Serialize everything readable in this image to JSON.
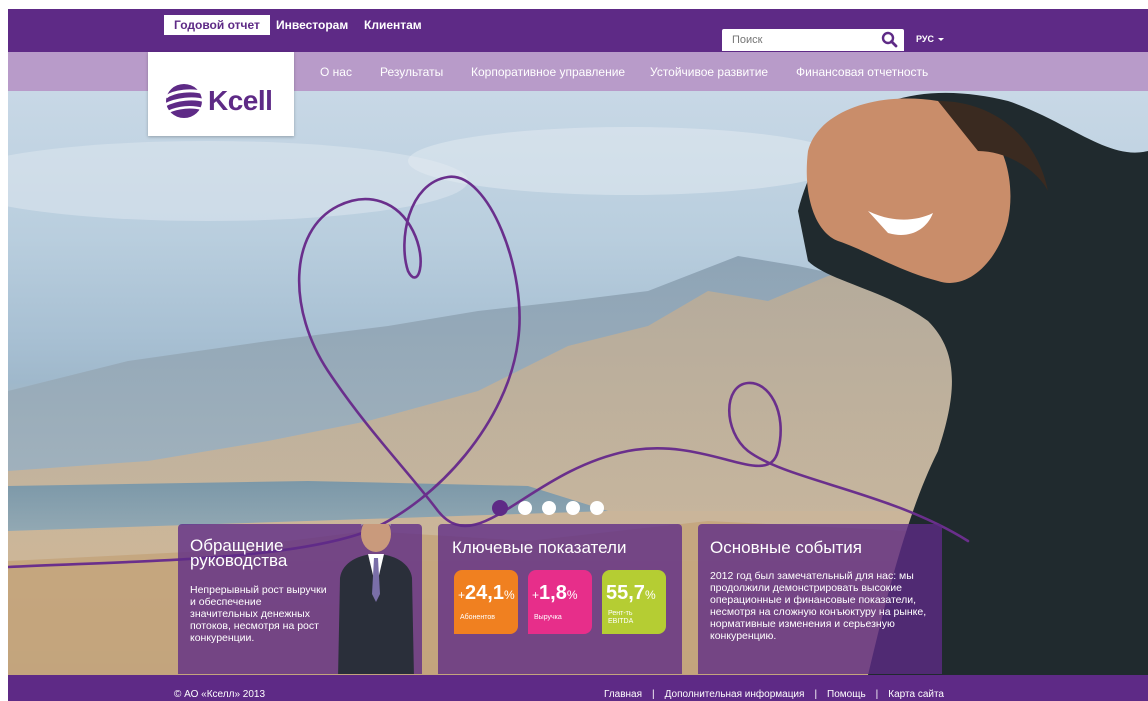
{
  "top_tabs": [
    {
      "label": "Годовой отчет",
      "active": true
    },
    {
      "label": "Инвесторам",
      "active": false
    },
    {
      "label": "Клиентам",
      "active": false
    }
  ],
  "search": {
    "placeholder": "Поиск",
    "icon": "search-icon"
  },
  "language": {
    "label": "РУС"
  },
  "nav": [
    {
      "label": "О нас"
    },
    {
      "label": "Результаты"
    },
    {
      "label": "Корпоративное управление"
    },
    {
      "label": "Устойчивое развитие"
    },
    {
      "label": "Финансовая отчетность"
    }
  ],
  "logo": {
    "text": "Kcell"
  },
  "carousel": {
    "total": 5,
    "active": 1
  },
  "panels": {
    "address": {
      "title": "Обращение руководства",
      "text": "Непрерывный рост выручки и обеспечение значительных денежных потоков, несмотря на рост конкуренции."
    },
    "indicators": {
      "title": "Ключевые показатели",
      "metrics": [
        {
          "sign": "+",
          "value": "24,1",
          "unit": "%",
          "label": "Абонентов",
          "color": "#f08020"
        },
        {
          "sign": "+",
          "value": "1,8",
          "unit": "%",
          "label": "Выручка",
          "color": "#e72e8a"
        },
        {
          "sign": "",
          "value": "55,7",
          "unit": "%",
          "label": "Рент-ть EBITDA",
          "color": "#b5cd33"
        }
      ]
    },
    "events": {
      "title": "Основные события",
      "text": "2012 год был замечательный для нас: мы продолжили демонстрировать высокие операционные и финансовые показатели, несмотря на сложную конъюктуру на рынке, нормативные изменения и серьезную конкуренцию."
    }
  },
  "footer": {
    "copyright": "© АО «Кселл» 2013",
    "links": [
      {
        "label": "Главная"
      },
      {
        "label": "Дополнительная информация"
      },
      {
        "label": "Помощь"
      },
      {
        "label": "Карта сайта"
      }
    ]
  },
  "colors": {
    "brand": "#5e2a86",
    "nav": "#b89bc9"
  }
}
